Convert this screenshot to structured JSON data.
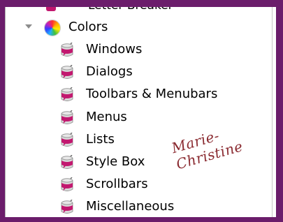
{
  "tree": {
    "cut_off_item": {
      "label": "Letter Breaker",
      "icon": "color-swatch-icon"
    },
    "parent": {
      "label": "Colors",
      "icon": "color-wheel-icon",
      "expanded": true
    },
    "children": [
      {
        "label": "Windows",
        "icon": "paint-can-icon"
      },
      {
        "label": "Dialogs",
        "icon": "paint-can-icon"
      },
      {
        "label": "Toolbars & Menubars",
        "icon": "paint-can-icon"
      },
      {
        "label": "Menus",
        "icon": "paint-can-icon"
      },
      {
        "label": "Lists",
        "icon": "paint-can-icon"
      },
      {
        "label": "Style Box",
        "icon": "paint-can-icon"
      },
      {
        "label": "Scrollbars",
        "icon": "paint-can-icon"
      },
      {
        "label": "Miscellaneous",
        "icon": "paint-can-icon"
      }
    ]
  },
  "signature": {
    "text": "Marie-Christine"
  },
  "colors": {
    "frame": "#6b1d6b",
    "icon_accent": "#c2186f",
    "signature": "#8a2a30"
  }
}
